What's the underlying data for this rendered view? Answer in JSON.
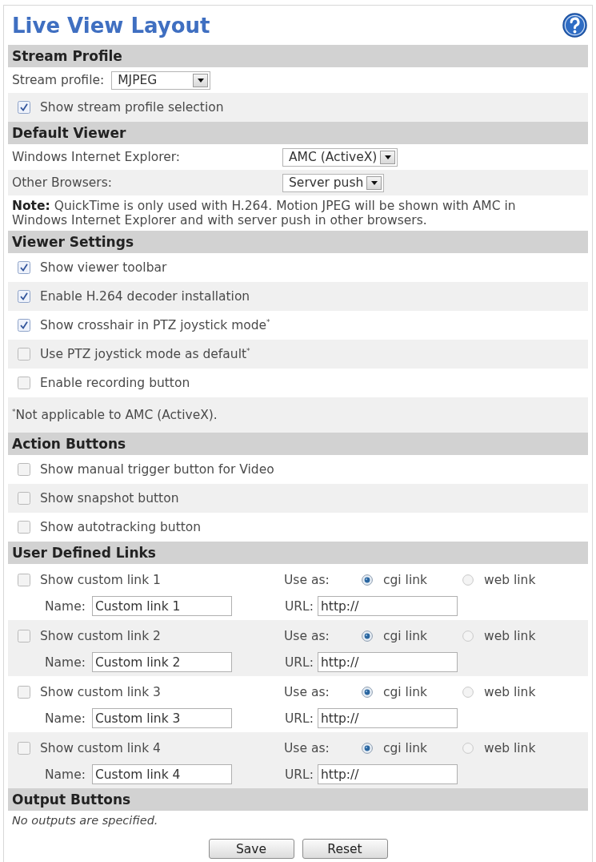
{
  "title": "Live View Layout",
  "sections": [
    {
      "heading": "Stream Profile",
      "rows": [
        {
          "kind": "select",
          "label": "Stream profile:",
          "value": "MJPEG"
        },
        {
          "kind": "checkbox",
          "label": "Show stream profile selection",
          "checked": true
        }
      ]
    },
    {
      "heading": "Default Viewer",
      "rows": [
        {
          "kind": "pair",
          "label": "Windows Internet Explorer:",
          "value": "AMC (ActiveX)"
        },
        {
          "kind": "pair",
          "label": "Other Browsers:",
          "value": "Server push"
        },
        {
          "kind": "note",
          "text": "**Note:** QuickTime is only used with H.264. Motion JPEG will be shown with AMC in Windows Internet Explorer and with server push in other browsers."
        }
      ]
    },
    {
      "heading": "Viewer Settings",
      "rows": [
        {
          "kind": "checkbox",
          "label": "Show viewer toolbar",
          "checked": true
        },
        {
          "kind": "checkbox",
          "label": "Enable H.264 decoder installation",
          "checked": true
        },
        {
          "kind": "checkbox",
          "label": "Show crosshair in PTZ joystick mode$^{*}$",
          "checked": true
        },
        {
          "kind": "checkbox",
          "label": "Use PTZ joystick mode as default$^{*}$",
          "checked": false
        },
        {
          "kind": "checkbox",
          "label": "Enable recording button",
          "checked": false
        },
        {
          "kind": "note",
          "text": "$^{*}$Not applicable to AMC (ActiveX)."
        }
      ]
    },
    {
      "heading": "Action Buttons",
      "rows": [
        {
          "kind": "checkbox",
          "label": "Show manual trigger button for Video",
          "checked": false
        },
        {
          "kind": "checkbox",
          "label": "Show snapshot button",
          "checked": false
        },
        {
          "kind": "checkbox",
          "label": "Show autotracking button",
          "checked": false
        }
      ]
    },
    {
      "heading": "User Defined Links",
      "rows": [
        {
          "kind": "link",
          "label": "Show custom link 1",
          "checked": false,
          "use_as": "Use as:",
          "options": [
            {
              "label": "cgi link",
              "selected": true
            },
            {
              "label": "web link",
              "selected": false
            }
          ],
          "name_label": "Name:",
          "name": "Custom link 1",
          "url_label": "URL:",
          "url": "http://"
        },
        {
          "kind": "link",
          "label": "Show custom link 2",
          "checked": false,
          "use_as": "Use as:",
          "options": [
            {
              "label": "cgi link",
              "selected": true
            },
            {
              "label": "web link",
              "selected": false
            }
          ],
          "name_label": "Name:",
          "name": "Custom link 2",
          "url_label": "URL:",
          "url": "http://"
        },
        {
          "kind": "link",
          "label": "Show custom link 3",
          "checked": false,
          "use_as": "Use as:",
          "options": [
            {
              "label": "cgi link",
              "selected": true
            },
            {
              "label": "web link",
              "selected": false
            }
          ],
          "name_label": "Name:",
          "name": "Custom link 3",
          "url_label": "URL:",
          "url": "http://"
        },
        {
          "kind": "link",
          "label": "Show custom link 4",
          "checked": false,
          "use_as": "Use as:",
          "options": [
            {
              "label": "cgi link",
              "selected": true
            },
            {
              "label": "web link",
              "selected": false
            }
          ],
          "name_label": "Name:",
          "name": "Custom link 4",
          "url_label": "URL:",
          "url": "http://"
        }
      ]
    },
    {
      "heading": "Output Buttons",
      "rows": [
        {
          "kind": "info",
          "text": "No outputs are specified."
        }
      ]
    }
  ],
  "buttons": [
    "Save",
    "Reset"
  ]
}
